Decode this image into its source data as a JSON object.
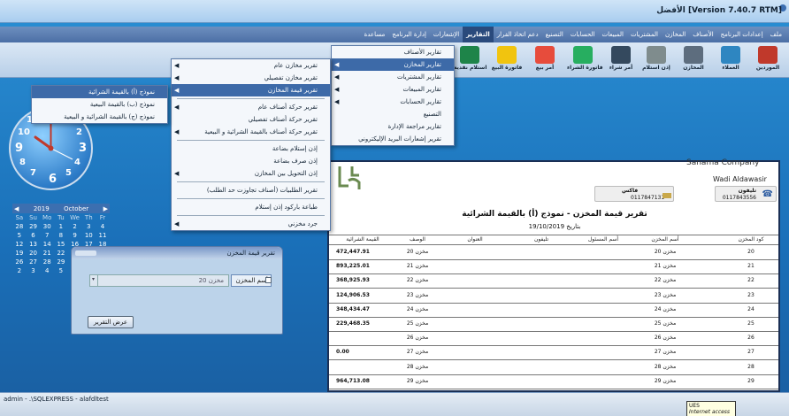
{
  "window": {
    "title": "الأفضل [Version 7.40.7 RTM]"
  },
  "menubar": [
    {
      "label": "ملف",
      "active": false
    },
    {
      "label": "إعدادات البرنامج",
      "active": false
    },
    {
      "label": "الأصناف",
      "active": false
    },
    {
      "label": "المخازن",
      "active": false
    },
    {
      "label": "المشتريات",
      "active": false
    },
    {
      "label": "المبيعات",
      "active": false
    },
    {
      "label": "الحسابات",
      "active": false
    },
    {
      "label": "التصنيع",
      "active": false
    },
    {
      "label": "دعم اتخاذ القرار",
      "active": false
    },
    {
      "label": "التقارير",
      "active": true
    },
    {
      "label": "الإشعارات",
      "active": false
    },
    {
      "label": "إدارة البرنامج",
      "active": false
    },
    {
      "label": "مساعدة",
      "active": false
    }
  ],
  "toolbar": [
    {
      "label": "الموردين",
      "icon": "suppliers-icon",
      "color": "#c0392b"
    },
    {
      "label": "العملاء",
      "icon": "customers-icon",
      "color": "#2e86c1"
    },
    {
      "label": "المخازن",
      "icon": "warehouses-icon",
      "color": "#5d6d7e"
    },
    {
      "label": "إذن استلام",
      "icon": "receipt-icon",
      "color": "#7f8c8d"
    },
    {
      "label": "أمر شراء",
      "icon": "purchase-order-icon",
      "color": "#34495e"
    },
    {
      "label": "فاتورة الشراء",
      "icon": "purchase-invoice-icon",
      "color": "#27ae60"
    },
    {
      "label": "أمر بيع",
      "icon": "sale-order-icon",
      "color": "#e74c3c"
    },
    {
      "label": "فاتورة البيع",
      "icon": "sale-invoice-icon",
      "color": "#f1c40f"
    },
    {
      "label": "استلام نقدية",
      "icon": "cash-receipt-icon",
      "color": "#1e8449"
    }
  ],
  "reports_menu": [
    {
      "label": "تقارير الأصناف",
      "highlight": false
    },
    {
      "label": "تقارير المخازن",
      "highlight": true
    },
    {
      "label": "تقارير المشتريات",
      "highlight": false
    },
    {
      "label": "تقارير المبيعات",
      "highlight": false
    },
    {
      "label": "تقارير الحسابات",
      "highlight": false
    },
    {
      "label": "التصنيع",
      "highlight": false
    },
    {
      "label": "تقارير مراجعة الإدارة",
      "highlight": false
    },
    {
      "label": "تقرير إشعارات البريد الإليكتروني",
      "highlight": false
    }
  ],
  "warehouse_menu": [
    {
      "label": "تقرير مخازن عام",
      "sub": true,
      "highlight": false,
      "sep_after": false
    },
    {
      "label": "تقرير مخازن تفصيلي",
      "sub": true,
      "highlight": false,
      "sep_after": false
    },
    {
      "label": "تقرير قيمة المخازن",
      "sub": true,
      "highlight": true,
      "sep_after": true
    },
    {
      "label": "تقرير حركة أصناف عام",
      "sub": true,
      "highlight": false,
      "sep_after": false
    },
    {
      "label": "تقرير حركة أصناف تفصيلي",
      "sub": false,
      "highlight": false,
      "sep_after": false
    },
    {
      "label": "تقرير حركة أصناف بالقيمة الشرائية و البيعية",
      "sub": true,
      "highlight": false,
      "sep_after": true
    },
    {
      "label": "إذن إستلام بضاعة",
      "sub": false,
      "highlight": false,
      "sep_after": false
    },
    {
      "label": "إذن صرف بضاعة",
      "sub": false,
      "highlight": false,
      "sep_after": false
    },
    {
      "label": "إذن التحويل بين المخازن",
      "sub": true,
      "highlight": false,
      "sep_after": true
    },
    {
      "label": "تقرير الطلبيات (أصناف تجاوزت حد الطلب)",
      "sub": false,
      "highlight": false,
      "sep_after": true
    },
    {
      "label": "طباعة باركود إذن إستلام",
      "sub": false,
      "highlight": false,
      "sep_after": true
    },
    {
      "label": "جرد مخزني",
      "sub": true,
      "highlight": false,
      "sep_after": false
    }
  ],
  "value_menu": [
    {
      "label": "نموذج (أ) بالقيمة الشرائية",
      "highlight": true
    },
    {
      "label": "نموذج (ب) بالقيمة البيعية",
      "highlight": false
    },
    {
      "label": "نموذج (ج) بالقيمة الشرائية و البيعية",
      "highlight": false
    }
  ],
  "clock": {
    "numbers": [
      "12",
      "3",
      "6",
      "9",
      "11",
      "10",
      "4",
      "5",
      "7",
      "8",
      "1",
      "2"
    ]
  },
  "calendar": {
    "year": "2019",
    "month": "October",
    "days_header": [
      "Sa",
      "Su",
      "Mo",
      "Tu",
      "We",
      "Th",
      "Fr"
    ],
    "weeks": [
      [
        "28",
        "29",
        "30",
        "1",
        "2",
        "3",
        "4"
      ],
      [
        "5",
        "6",
        "7",
        "8",
        "9",
        "10",
        "11"
      ],
      [
        "12",
        "13",
        "14",
        "15",
        "16",
        "17",
        "18"
      ],
      [
        "19",
        "20",
        "21",
        "22",
        "23",
        "24",
        "25"
      ],
      [
        "26",
        "27",
        "28",
        "29",
        "30",
        "31",
        "1"
      ],
      [
        "2",
        "3",
        "4",
        "5",
        "6",
        "7",
        "8"
      ]
    ]
  },
  "small_window": {
    "title": "تقرير قيمة المخزن",
    "store_label": "أسم المخزن",
    "store_value": "مخزن 20",
    "show_button": "عرض التقرير"
  },
  "report": {
    "company": "Sanama Company",
    "address": "Wadi Aldawasir",
    "phone_label": "تليفون",
    "phone": "0117843556",
    "fax_label": "فاكس",
    "fax": "0117847131",
    "title": "تقرير قيمة المخزن - نموذج (أ) بالقيمة الشرائية",
    "date_label": "بتاريخ",
    "date": "19/10/2019",
    "columns": [
      "كود المخزن",
      "أسم المخزن",
      "أسم المسئول",
      "تليفون",
      "العنوان",
      "الوصف",
      "القيمة الشرائية"
    ],
    "rows": [
      [
        "20",
        "مخزن 20",
        "",
        "",
        "",
        "مخزن 20",
        "472,447.91"
      ],
      [
        "21",
        "مخزن 21",
        "",
        "",
        "",
        "مخزن 21",
        "893,225.01"
      ],
      [
        "22",
        "مخزن 22",
        "",
        "",
        "",
        "مخزن 22",
        "368,925.93"
      ],
      [
        "23",
        "مخزن 23",
        "",
        "",
        "",
        "مخزن 23",
        "124,906.53"
      ],
      [
        "24",
        "مخزن 24",
        "",
        "",
        "",
        "مخزن 24",
        "348,434.47"
      ],
      [
        "25",
        "مخزن 25",
        "",
        "",
        "",
        "مخزن 25",
        "229,468.35"
      ],
      [
        "26",
        "مخزن 26",
        "",
        "",
        "",
        "مخزن 26",
        ""
      ],
      [
        "27",
        "مخزن 27",
        "",
        "",
        "",
        "مخزن 27",
        "0.00"
      ],
      [
        "28",
        "مخزن 28",
        "",
        "",
        "",
        "مخزن 28",
        ""
      ],
      [
        "29",
        "مخزن 29",
        "",
        "",
        "",
        "مخزن 29",
        "964,713.08"
      ]
    ]
  },
  "status": {
    "text": "admin  -  .\\SQLEXPRESS  -  alafdltest",
    "tooltip_title": "UES",
    "tooltip_text": "Internet access"
  }
}
